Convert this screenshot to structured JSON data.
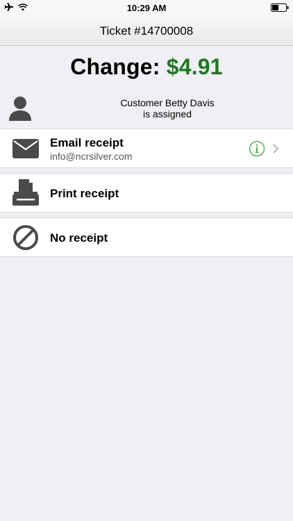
{
  "status_bar": {
    "time": "10:29 AM",
    "icons": [
      "airplane-icon",
      "wifi-icon",
      "battery-icon"
    ]
  },
  "nav": {
    "title": "Ticket #14700008"
  },
  "change": {
    "label": "Change:",
    "amount": "$4.91",
    "amount_color": "#1c7a1c"
  },
  "customer": {
    "icon": "person-icon",
    "line1": "Customer Betty Davis",
    "line2": "is assigned"
  },
  "receipts": [
    {
      "icon": "envelope-icon",
      "title": "Email receipt",
      "subtitle": "info@ncrsilver.com",
      "accessory": [
        "info-icon",
        "chevron-right-icon"
      ]
    },
    {
      "icon": "printer-icon",
      "title": "Print receipt"
    },
    {
      "icon": "prohibited-icon",
      "title": "No receipt"
    }
  ],
  "colors": {
    "background": "#efeff4",
    "accent_green": "#1c7a1c",
    "info_green": "#4cb84c",
    "icon_gray": "#4a4a4a"
  }
}
